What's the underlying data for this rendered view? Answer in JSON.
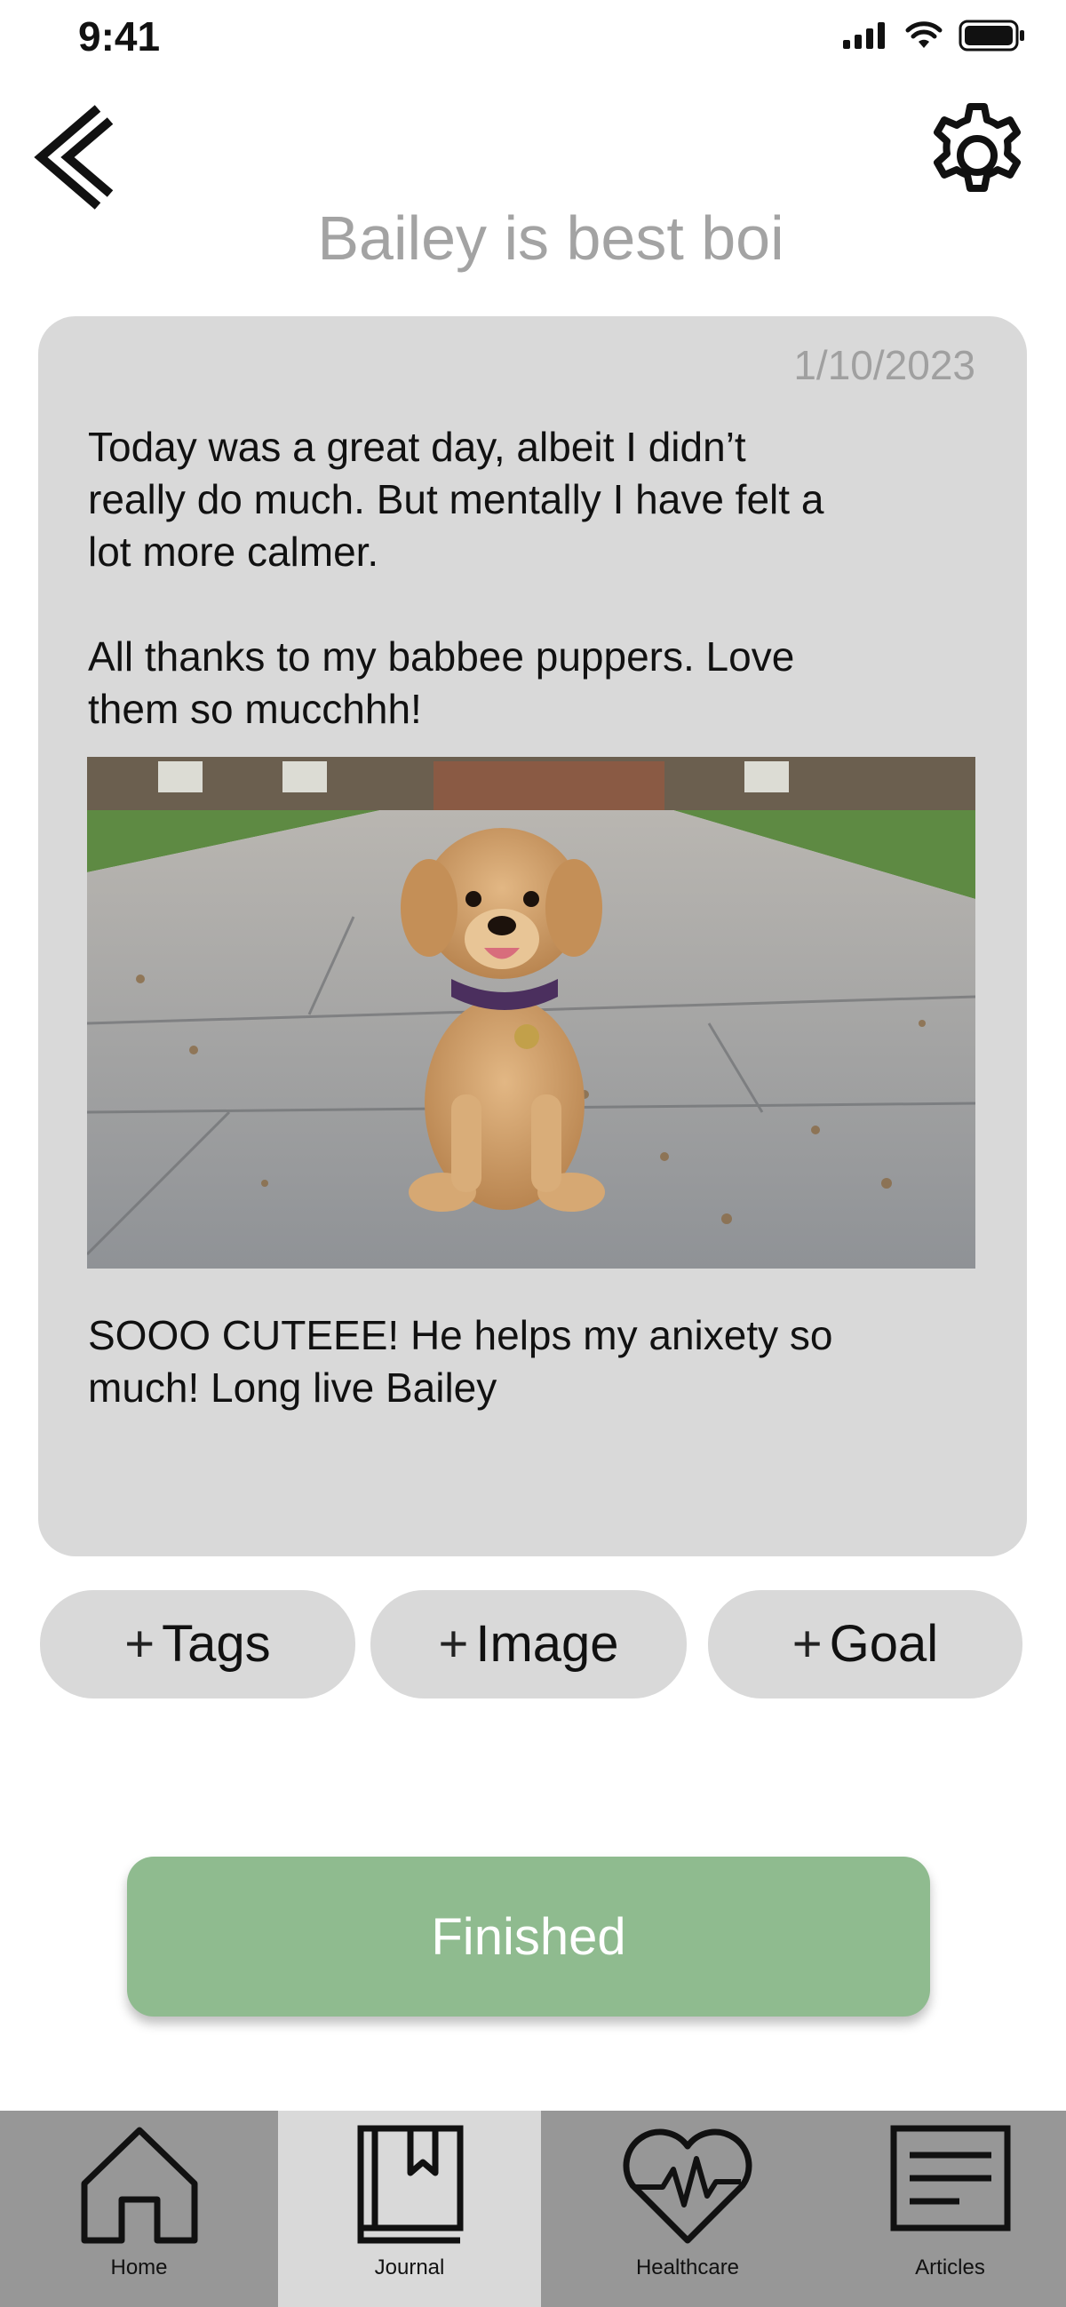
{
  "status": {
    "time": "9:41",
    "icons": [
      "signal-icon",
      "wifi-icon",
      "battery-icon"
    ]
  },
  "header": {
    "title": "Bailey is best boi",
    "back_icon": "chevron-left-icon",
    "settings_icon": "gear-icon"
  },
  "entry": {
    "date": "1/10/2023",
    "text_before": "Today was a great day, albeit I didn’t\nreally do much. But mentally I have felt a\nlot more calmer.\n\nAll thanks to my babbee puppers. Love\nthem so mucchhh!",
    "image": "golden-retriever-puppy-photo",
    "text_after": "SOOO CUTEEE! He helps my anixety so\nmuch! Long live Bailey"
  },
  "actions": {
    "plus": "+",
    "tags_label": "Tags",
    "image_label": "Image",
    "goal_label": "Goal"
  },
  "finished_label": "Finished",
  "nav": {
    "home": "Home",
    "journal": "Journal",
    "healthcare": "Healthcare",
    "articles": "Articles",
    "active": "journal"
  },
  "colors": {
    "card": "#d9d9d9",
    "finished": "#8fbb8f",
    "nav_bg": "#979797",
    "title": "#a3a3a3"
  }
}
